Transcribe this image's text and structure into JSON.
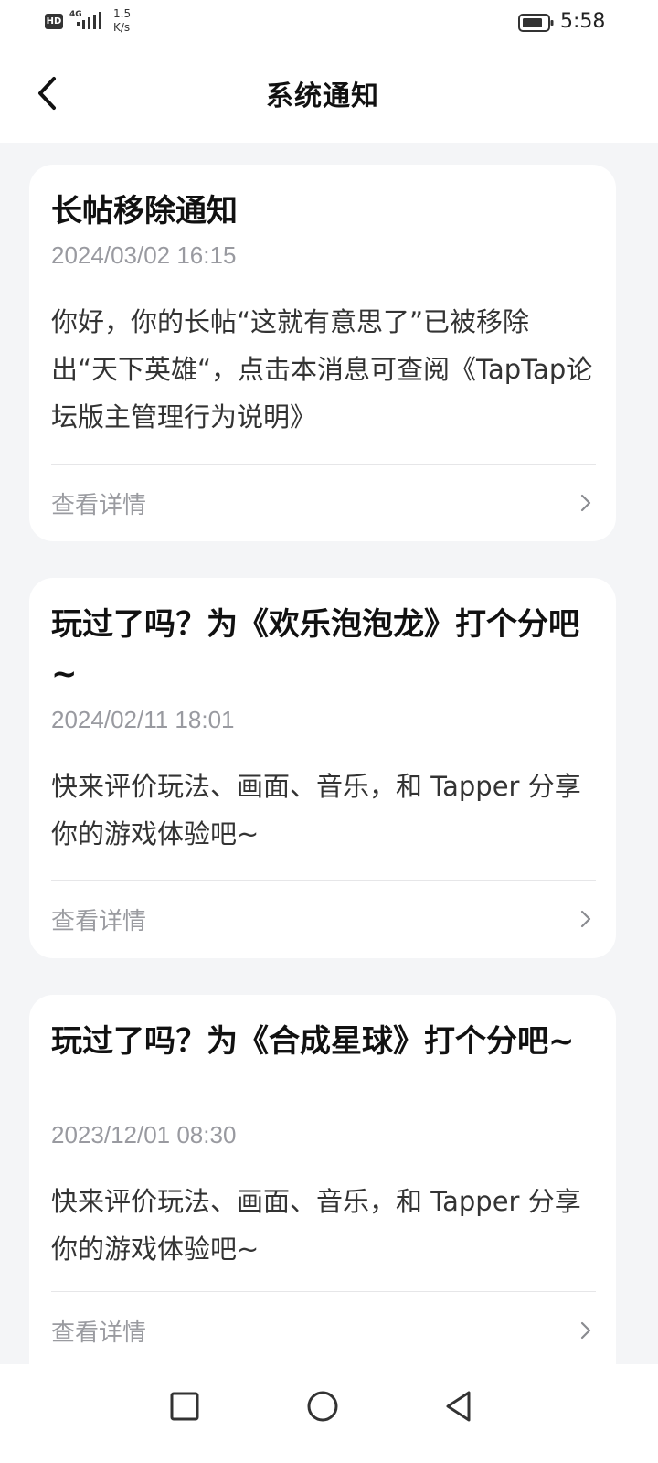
{
  "status_bar": {
    "hd_label": "HD",
    "network_gen": "4G",
    "speed_value": "1.5",
    "speed_unit": "K/s",
    "time": "5:58",
    "icons": [
      "signal-icon",
      "battery-icon"
    ]
  },
  "header": {
    "title": "系统通知",
    "back_icon": "back-arrow-icon"
  },
  "notifications": [
    {
      "title": "长帖移除通知",
      "time": "2024/03/02 16:15",
      "body": "你好，你的长帖“这就有意思了”已被移除出“天下英雄“，点击本消息可查阅《TapTap论坛版主管理行为说明》",
      "action": "查看详情"
    },
    {
      "title": "玩过了吗？为《欢乐泡泡龙》打个分吧~",
      "time": "2024/02/11 18:01",
      "body": "快来评价玩法、画面、音乐，和 Tapper 分享你的游戏体验吧~",
      "action": "查看详情"
    },
    {
      "title": "玩过了吗？为《合成星球》打个分吧~",
      "time": "2023/12/01 08:30",
      "body": "快来评价玩法、画面、音乐，和 Tapper 分享你的游戏体验吧~",
      "action": "查看详情"
    }
  ],
  "nav_bar": {
    "icons": [
      "recent-apps-icon",
      "home-icon",
      "back-triangle-icon"
    ]
  },
  "colors": {
    "background": "#f4f5f7",
    "card": "#ffffff",
    "secondary_text": "#999aa0"
  }
}
